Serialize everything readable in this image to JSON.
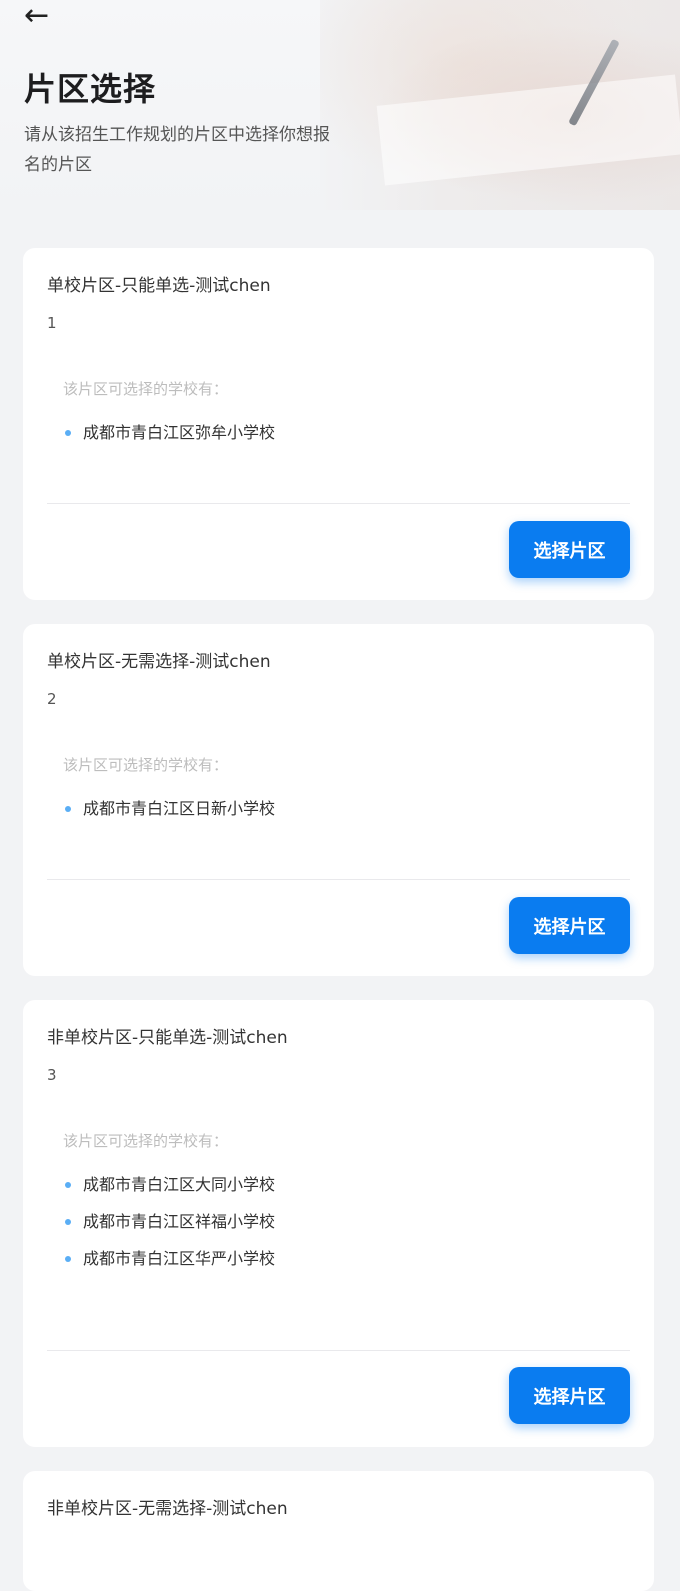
{
  "header": {
    "back_icon": "←",
    "title": "片区选择",
    "description": "请从该招生工作规划的片区中选择你想报名的片区"
  },
  "cards": [
    {
      "title": "单校片区-只能单选-测试chen",
      "number": "1",
      "schools_label": "该片区可选择的学校有：",
      "schools": [
        "成都市青白江区弥牟小学校"
      ],
      "button": "选择片区"
    },
    {
      "title": "单校片区-无需选择-测试chen",
      "number": "2",
      "schools_label": "该片区可选择的学校有：",
      "schools": [
        "成都市青白江区日新小学校"
      ],
      "button": "选择片区"
    },
    {
      "title": "非单校片区-只能单选-测试chen",
      "number": "3",
      "schools_label": "该片区可选择的学校有：",
      "schools": [
        "成都市青白江区大同小学校",
        "成都市青白江区祥福小学校",
        "成都市青白江区华严小学校"
      ],
      "button": "选择片区"
    },
    {
      "title": "非单校片区-无需选择-测试chen"
    }
  ],
  "colors": {
    "accent": "#0a7cf0",
    "bullet": "#5aaef5",
    "background": "#f2f3f5"
  }
}
